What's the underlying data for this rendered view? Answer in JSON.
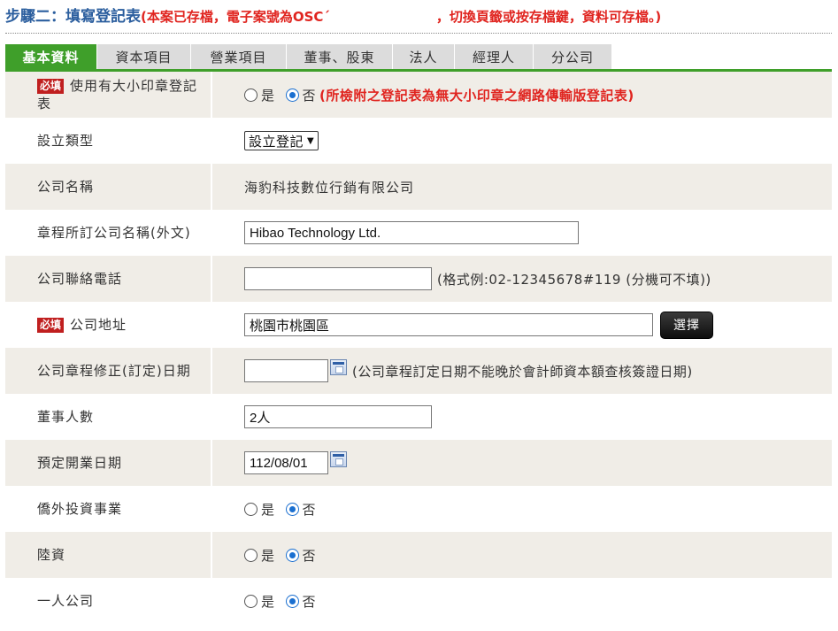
{
  "header": {
    "step": "步驟二：填寫登記表",
    "note_left": "(本案已存檔，電子案號為OSC´",
    "note_right": "，切換頁籤或按存檔鍵，資料可存檔。)"
  },
  "tabs": [
    {
      "label": "基本資料",
      "active": true
    },
    {
      "label": "資本項目"
    },
    {
      "label": "營業項目"
    },
    {
      "label": "董事、股東"
    },
    {
      "label": "法人"
    },
    {
      "label": "經理人"
    },
    {
      "label": "分公司"
    }
  ],
  "required_badge": "必填",
  "radio_yes": "是",
  "radio_no": "否",
  "form": {
    "seal": {
      "label": "使用有大小印章登記表",
      "note": "(所檢附之登記表為無大小印章之網路傳輸版登記表)",
      "selected": "否"
    },
    "establish_type": {
      "label": "設立類型",
      "value": "設立登記"
    },
    "company_name": {
      "label": "公司名稱",
      "value": "海豹科技數位行銷有限公司"
    },
    "foreign_name": {
      "label": "章程所訂公司名稱(外文)",
      "value": "Hibao Technology Ltd."
    },
    "phone": {
      "label": "公司聯絡電話",
      "value": "",
      "hint": "(格式例:02-12345678#119 (分機可不填))"
    },
    "address": {
      "label": "公司地址",
      "value": "桃園市桃園區",
      "button": "選擇"
    },
    "charter_date": {
      "label": "公司章程修正(訂定)日期",
      "value": "",
      "hint": "(公司章程訂定日期不能晚於會計師資本額查核簽證日期)"
    },
    "director_count": {
      "label": "董事人數",
      "value": "2人"
    },
    "open_date": {
      "label": "預定開業日期",
      "value": "112/08/01"
    },
    "overseas_chinese": {
      "label": "僑外投資事業",
      "selected": "否"
    },
    "mainland": {
      "label": "陸資",
      "selected": "否"
    },
    "one_person": {
      "label": "一人公司",
      "selected": "否"
    }
  }
}
